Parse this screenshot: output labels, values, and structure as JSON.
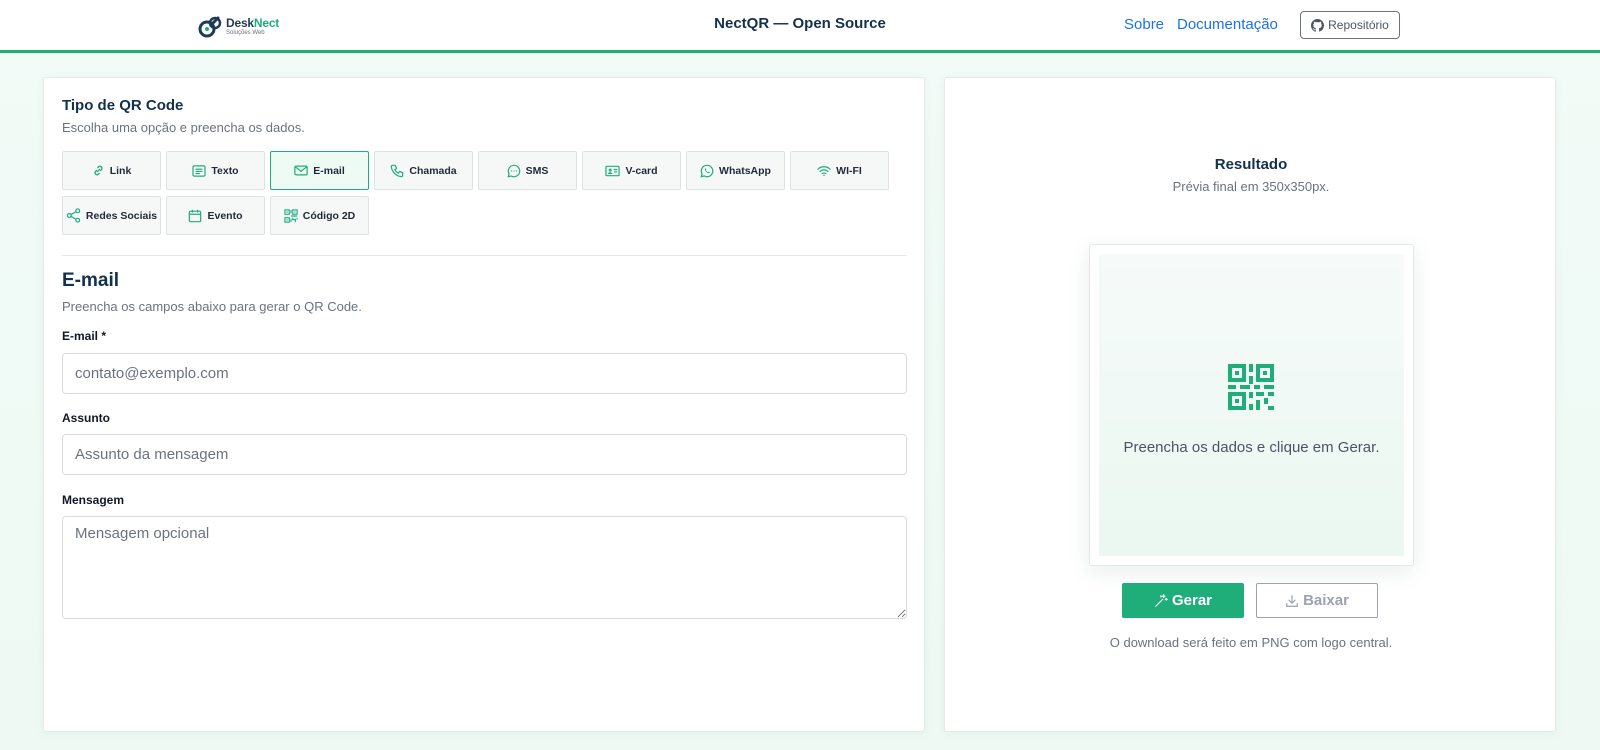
{
  "header": {
    "logo_title_main": "Desk",
    "logo_title_accent": "Nect",
    "logo_subtitle": "Soluções Web",
    "title": "NectQR — Open Source",
    "nav": [
      {
        "label": "Sobre"
      },
      {
        "label": "Documentação"
      }
    ],
    "repo_label": "Repositório"
  },
  "left": {
    "section_title": "Tipo de QR Code",
    "section_subtitle": "Escolha uma opção e preencha os dados.",
    "types": [
      {
        "label": "Link",
        "icon": "link-icon",
        "active": false
      },
      {
        "label": "Texto",
        "icon": "text-icon",
        "active": false
      },
      {
        "label": "E-mail",
        "icon": "mail-icon",
        "active": true
      },
      {
        "label": "Chamada",
        "icon": "phone-icon",
        "active": false
      },
      {
        "label": "SMS",
        "icon": "chat-icon",
        "active": false
      },
      {
        "label": "V-card",
        "icon": "vcard-icon",
        "active": false
      },
      {
        "label": "WhatsApp",
        "icon": "whatsapp-icon",
        "active": false
      },
      {
        "label": "WI-FI",
        "icon": "wifi-icon",
        "active": false
      },
      {
        "label": "Redes Sociais",
        "icon": "share-icon",
        "active": false
      },
      {
        "label": "Evento",
        "icon": "calendar-icon",
        "active": false
      },
      {
        "label": "Código 2D",
        "icon": "qr-icon",
        "active": false
      }
    ],
    "form": {
      "title": "E-mail",
      "subtitle": "Preencha os campos abaixo para gerar o QR Code.",
      "email_label": "E-mail *",
      "email_placeholder": "contato@exemplo.com",
      "email_value": "",
      "subject_label": "Assunto",
      "subject_placeholder": "Assunto da mensagem",
      "subject_value": "",
      "message_label": "Mensagem",
      "message_placeholder": "Mensagem opcional",
      "message_value": ""
    }
  },
  "right": {
    "title": "Resultado",
    "subtitle": "Prévia final em 350x350px.",
    "preview_text": "Preencha os dados e clique em Gerar.",
    "generate_label": "Gerar",
    "download_label": "Baixar",
    "note": "O download será feito em PNG com logo central."
  },
  "colors": {
    "accent": "#1fae7a",
    "heading": "#13314d",
    "link": "#1a73e8"
  }
}
